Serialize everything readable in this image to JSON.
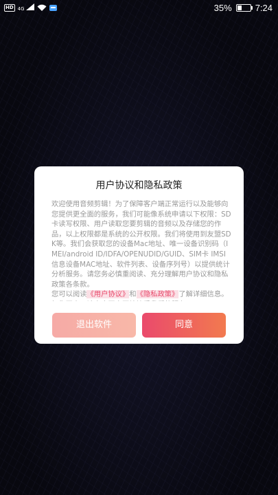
{
  "status_bar": {
    "hd": "HD",
    "network": "4G",
    "battery_percent": "35%",
    "battery_level": 0.35,
    "time": "7:24",
    "icons": [
      "hd-icon",
      "signal-icon",
      "wifi-icon",
      "message-icon",
      "battery-icon"
    ]
  },
  "dialog": {
    "title": "用户协议和隐私政策",
    "paragraph1": "欢迎使用音频剪辑！为了保障客户端正常运行以及能够向您提供更全面的服务，我们可能像系统申请以下权限：SD卡读写权限、用户读取您要剪辑的音频以及存储您的作品，以上权限都是系统的公开权限。我们将使用到友盟SDK等。我们会获取您的设备Mac地址、唯一设备识别码（IMEI/android ID/IDFA/OPENUDID/GUID、SIM卡 IMSI 信息设备MAC地址、软件列表、设备序列号）以提供统计分析服务。请您务必慎重阅读、充分理解用户协议和隐私政策各条款。",
    "p2_prefix": "您可以阅读",
    "user_agreement_link": "《用户协议》",
    "p2_and": "和",
    "privacy_policy_link": "《隐私政策》",
    "p2_suffix": "了解详细信息。如您同意，请点击同意开始接受我们的服务",
    "exit_button": "退出软件",
    "agree_button": "同意"
  }
}
